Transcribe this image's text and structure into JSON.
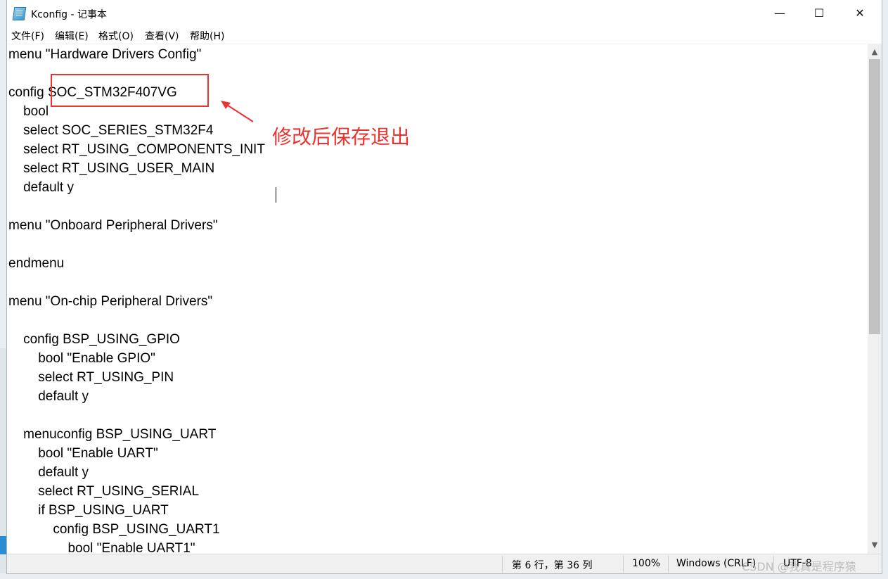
{
  "window": {
    "title": "Kconfig - 记事本",
    "controls": {
      "minimize": "—",
      "maximize": "☐",
      "close": "✕"
    }
  },
  "menubar": {
    "items": [
      "文件(F)",
      "编辑(E)",
      "格式(O)",
      "查看(V)",
      "帮助(H)"
    ]
  },
  "editor": {
    "lines": [
      "menu \"Hardware Drivers Config\"",
      "",
      "config SOC_STM32F407VG",
      "    bool",
      "    select SOC_SERIES_STM32F4",
      "    select RT_USING_COMPONENTS_INIT",
      "    select RT_USING_USER_MAIN",
      "    default y",
      "",
      "menu \"Onboard Peripheral Drivers\"",
      "",
      "endmenu",
      "",
      "menu \"On-chip Peripheral Drivers\"",
      "",
      "    config BSP_USING_GPIO",
      "        bool \"Enable GPIO\"",
      "        select RT_USING_PIN",
      "        default y",
      "",
      "    menuconfig BSP_USING_UART",
      "        bool \"Enable UART\"",
      "        default y",
      "        select RT_USING_SERIAL",
      "        if BSP_USING_UART",
      "            config BSP_USING_UART1",
      "                bool \"Enable UART1\""
    ]
  },
  "annotation": {
    "text": "修改后保存退出",
    "color": "#e8332f"
  },
  "statusbar": {
    "position": "第 6 行，第 36 列",
    "zoom": "100%",
    "line_ending": "Windows (CRLF)",
    "encoding": "UTF-8"
  },
  "watermark": "CSDN @我真是程序猿"
}
